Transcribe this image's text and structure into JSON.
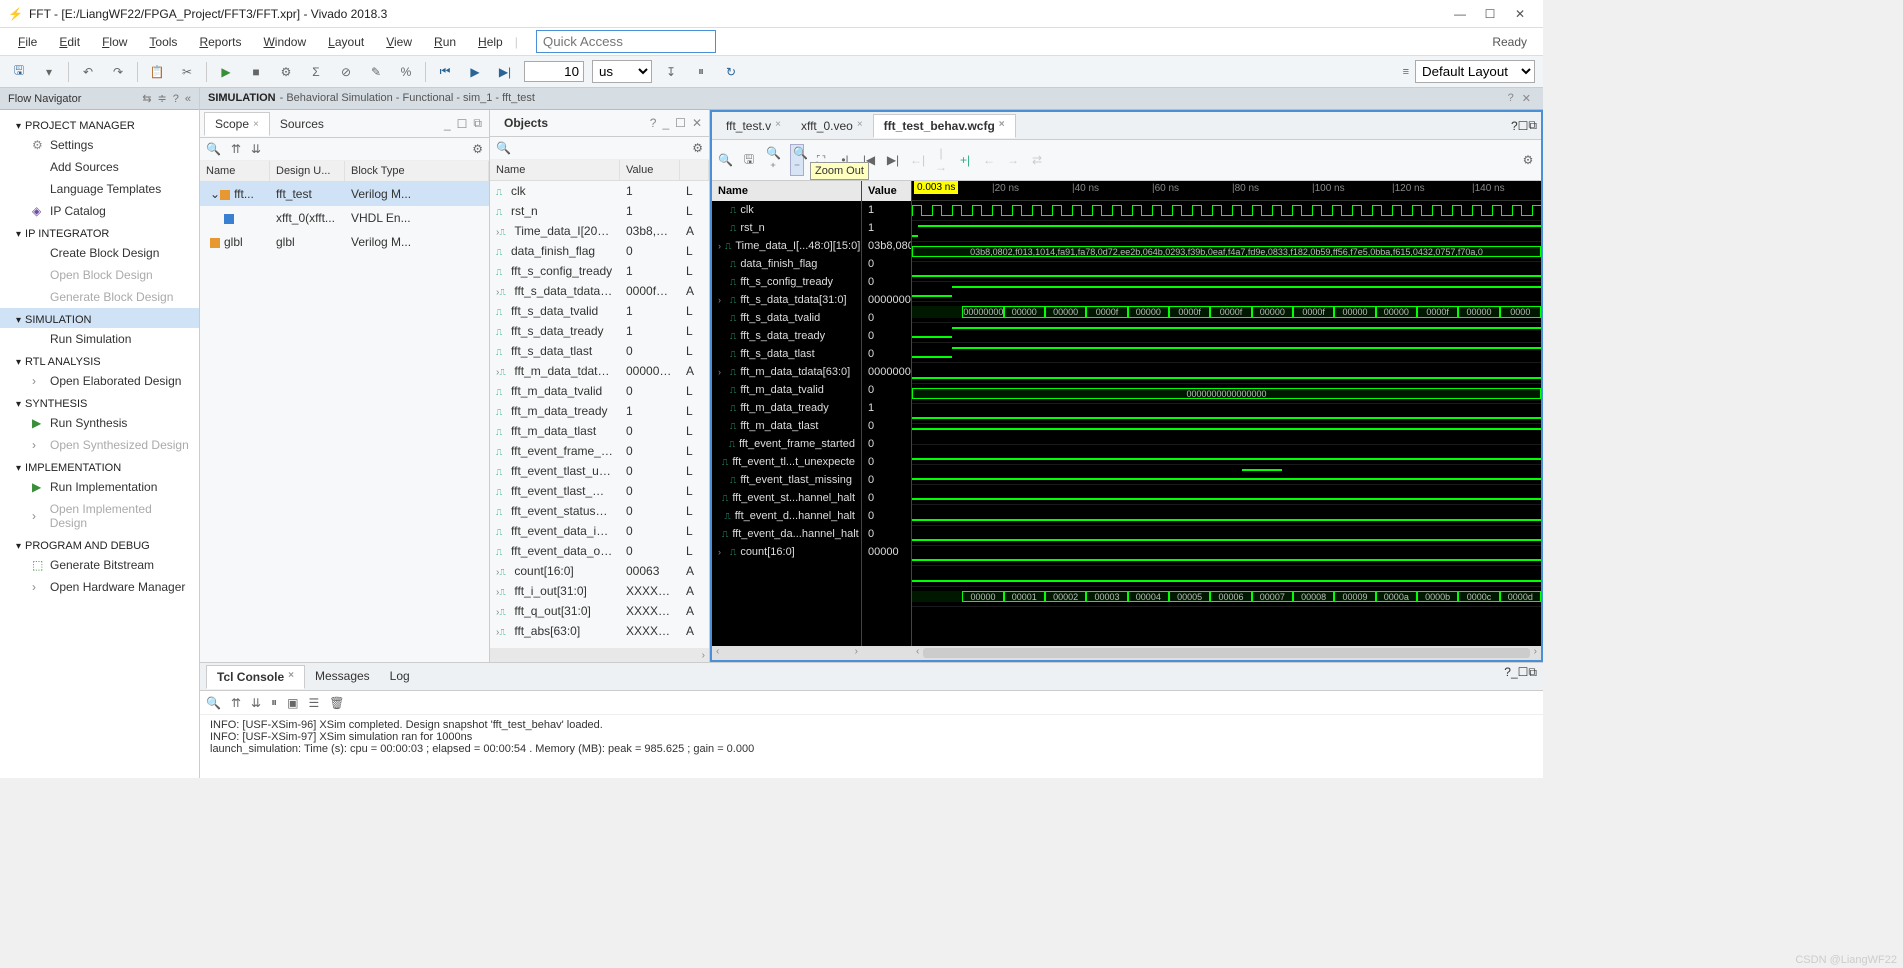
{
  "title": "FFT - [E:/LiangWF22/FPGA_Project/FFT3/FFT.xpr] - Vivado 2018.3",
  "menu": {
    "items": [
      "File",
      "Edit",
      "Flow",
      "Tools",
      "Reports",
      "Window",
      "Layout",
      "View",
      "Run",
      "Help"
    ],
    "search_placeholder": "Quick Access",
    "status": "Ready"
  },
  "toolbar": {
    "time_value": "10",
    "time_unit": "us",
    "layout": "Default Layout"
  },
  "zoom_tooltip": "Zoom Out",
  "flow_nav": {
    "title": "Flow Navigator",
    "sections": [
      {
        "label": "PROJECT MANAGER",
        "items": [
          {
            "label": "Settings",
            "icon": "gear"
          },
          {
            "label": "Add Sources"
          },
          {
            "label": "Language Templates"
          },
          {
            "label": "IP Catalog",
            "icon": "ip"
          }
        ]
      },
      {
        "label": "IP INTEGRATOR",
        "items": [
          {
            "label": "Create Block Design"
          },
          {
            "label": "Open Block Design",
            "dim": true
          },
          {
            "label": "Generate Block Design",
            "dim": true
          }
        ]
      },
      {
        "label": "SIMULATION",
        "sel": true,
        "items": [
          {
            "label": "Run Simulation"
          }
        ]
      },
      {
        "label": "RTL ANALYSIS",
        "items": [
          {
            "label": "Open Elaborated Design",
            "chevron": true
          }
        ]
      },
      {
        "label": "SYNTHESIS",
        "items": [
          {
            "label": "Run Synthesis",
            "icon": "play"
          },
          {
            "label": "Open Synthesized Design",
            "chevron": true,
            "dim": true
          }
        ]
      },
      {
        "label": "IMPLEMENTATION",
        "items": [
          {
            "label": "Run Implementation",
            "icon": "play"
          },
          {
            "label": "Open Implemented Design",
            "chevron": true,
            "dim": true
          }
        ]
      },
      {
        "label": "PROGRAM AND DEBUG",
        "items": [
          {
            "label": "Generate Bitstream",
            "icon": "bits"
          },
          {
            "label": "Open Hardware Manager",
            "chevron": true
          }
        ]
      }
    ]
  },
  "crumb": {
    "prefix": "SIMULATION",
    "rest": "- Behavioral Simulation - Functional - sim_1 - fft_test"
  },
  "scope": {
    "tabs": [
      "Scope",
      "Sources"
    ],
    "cols": [
      "Name",
      "Design U...",
      "Block Type"
    ],
    "rows": [
      {
        "name": "fft...",
        "du": "fft_test",
        "bt": "Verilog M...",
        "sel": true,
        "ind": 0,
        "sq": "or",
        "exp": true
      },
      {
        "name": "",
        "du": "xfft_0(xfft...",
        "bt": "VHDL En...",
        "ind": 1,
        "sq": "bl"
      },
      {
        "name": "glbl",
        "du": "glbl",
        "bt": "Verilog M...",
        "ind": 0,
        "sq": "or"
      }
    ]
  },
  "objects": {
    "title": "Objects",
    "cols": [
      "Name",
      "Value",
      ""
    ],
    "rows": [
      {
        "n": "clk",
        "v": "1",
        "d": "L"
      },
      {
        "n": "rst_n",
        "v": "1",
        "d": "L"
      },
      {
        "n": "Time_data_I[2048:...",
        "v": "03b8,08...",
        "d": "A",
        "exp": true
      },
      {
        "n": "data_finish_flag",
        "v": "0",
        "d": "L"
      },
      {
        "n": "fft_s_config_tready",
        "v": "1",
        "d": "L"
      },
      {
        "n": "fft_s_data_tdata[31...",
        "v": "0000fd55",
        "d": "A",
        "exp": true
      },
      {
        "n": "fft_s_data_tvalid",
        "v": "1",
        "d": "L"
      },
      {
        "n": "fft_s_data_tready",
        "v": "1",
        "d": "L"
      },
      {
        "n": "fft_s_data_tlast",
        "v": "0",
        "d": "L"
      },
      {
        "n": "fft_m_data_tdata[6...",
        "v": "000000...",
        "d": "A",
        "exp": true
      },
      {
        "n": "fft_m_data_tvalid",
        "v": "0",
        "d": "L"
      },
      {
        "n": "fft_m_data_tready",
        "v": "1",
        "d": "L"
      },
      {
        "n": "fft_m_data_tlast",
        "v": "0",
        "d": "L"
      },
      {
        "n": "fft_event_frame_st...",
        "v": "0",
        "d": "L"
      },
      {
        "n": "fft_event_tlast_une...",
        "v": "0",
        "d": "L"
      },
      {
        "n": "fft_event_tlast_mis...",
        "v": "0",
        "d": "L"
      },
      {
        "n": "fft_event_status_c...",
        "v": "0",
        "d": "L"
      },
      {
        "n": "fft_event_data_in_...",
        "v": "0",
        "d": "L"
      },
      {
        "n": "fft_event_data_out...",
        "v": "0",
        "d": "L"
      },
      {
        "n": "count[16:0]",
        "v": "00063",
        "d": "A",
        "exp": true
      },
      {
        "n": "fft_i_out[31:0]",
        "v": "XXXXXXXX",
        "d": "A",
        "exp": true
      },
      {
        "n": "fft_q_out[31:0]",
        "v": "XXXXXXXX",
        "d": "A",
        "exp": true
      },
      {
        "n": "fft_abs[63:0]",
        "v": "XXXXXX...",
        "d": "A",
        "exp": true
      }
    ]
  },
  "wave": {
    "tabs": [
      {
        "label": "fft_test.v",
        "close": true
      },
      {
        "label": "xfft_0.veo",
        "close": true
      },
      {
        "label": "fft_test_behav.wcfg",
        "close": true,
        "active": true
      }
    ],
    "cursor": "0.003 ns",
    "name_col": "Name",
    "val_col": "Value",
    "time_ticks": [
      "20 ns",
      "40 ns",
      "60 ns",
      "80 ns",
      "100 ns",
      "120 ns",
      "140 ns"
    ],
    "signals": [
      {
        "n": "clk",
        "v": "1",
        "type": "clk"
      },
      {
        "n": "rst_n",
        "v": "1",
        "type": "step_hi"
      },
      {
        "n": "Time_data_I[...48:0][15:0]",
        "v": "03b8,080",
        "type": "bus",
        "bus_text": "03b8,0802,f013,1014,fa91,fa78,0d72,ee2b,064b,0293,f39b,0eaf,f4a7,fd9e,0833,f182,0b59,ff56,f7e5,0bba,f615,0432,0757,f70a,0",
        "exp": true
      },
      {
        "n": "data_finish_flag",
        "v": "0",
        "type": "lo"
      },
      {
        "n": "fft_s_config_tready",
        "v": "0",
        "type": "step2"
      },
      {
        "n": "fft_s_data_tdata[31:0]",
        "v": "00000000",
        "type": "bus_multi",
        "exp": true,
        "segs": [
          "00000000",
          "00000",
          "00000",
          "0000f",
          "00000",
          "0000f",
          "0000f",
          "00000",
          "0000f",
          "00000",
          "00000",
          "0000f",
          "00000",
          "0000"
        ]
      },
      {
        "n": "fft_s_data_tvalid",
        "v": "0",
        "type": "step2"
      },
      {
        "n": "fft_s_data_tready",
        "v": "0",
        "type": "step2"
      },
      {
        "n": "fft_s_data_tlast",
        "v": "0",
        "type": "lo"
      },
      {
        "n": "fft_m_data_tdata[63:0]",
        "v": "00000000",
        "type": "bus",
        "bus_text": "0000000000000000",
        "exp": true
      },
      {
        "n": "fft_m_data_tvalid",
        "v": "0",
        "type": "lo"
      },
      {
        "n": "fft_m_data_tready",
        "v": "1",
        "type": "hi"
      },
      {
        "n": "fft_m_data_tlast",
        "v": "0",
        "type": "lo"
      },
      {
        "n": "fft_event_frame_started",
        "v": "0",
        "type": "pulse"
      },
      {
        "n": "fft_event_tl...t_unexpecte",
        "v": "0",
        "type": "lo"
      },
      {
        "n": "fft_event_tlast_missing",
        "v": "0",
        "type": "lo"
      },
      {
        "n": "fft_event_st...hannel_halt",
        "v": "0",
        "type": "lo"
      },
      {
        "n": "fft_event_d...hannel_halt",
        "v": "0",
        "type": "lo"
      },
      {
        "n": "fft_event_da...hannel_halt",
        "v": "0",
        "type": "lo"
      },
      {
        "n": "count[16:0]",
        "v": "00000",
        "type": "bus_multi",
        "exp": true,
        "segs": [
          "00000",
          "00001",
          "00002",
          "00003",
          "00004",
          "00005",
          "00006",
          "00007",
          "00008",
          "00009",
          "0000a",
          "0000b",
          "0000c",
          "0000d"
        ]
      }
    ]
  },
  "console": {
    "tabs": [
      "Tcl Console",
      "Messages",
      "Log"
    ],
    "lines": [
      "INFO: [USF-XSim-96] XSim completed. Design snapshot 'fft_test_behav' loaded.",
      "INFO: [USF-XSim-97] XSim simulation ran for 1000ns",
      "launch_simulation: Time (s): cpu = 00:00:03 ; elapsed = 00:00:54 . Memory (MB): peak = 985.625 ; gain = 0.000"
    ]
  },
  "watermark": "CSDN @LiangWF22"
}
